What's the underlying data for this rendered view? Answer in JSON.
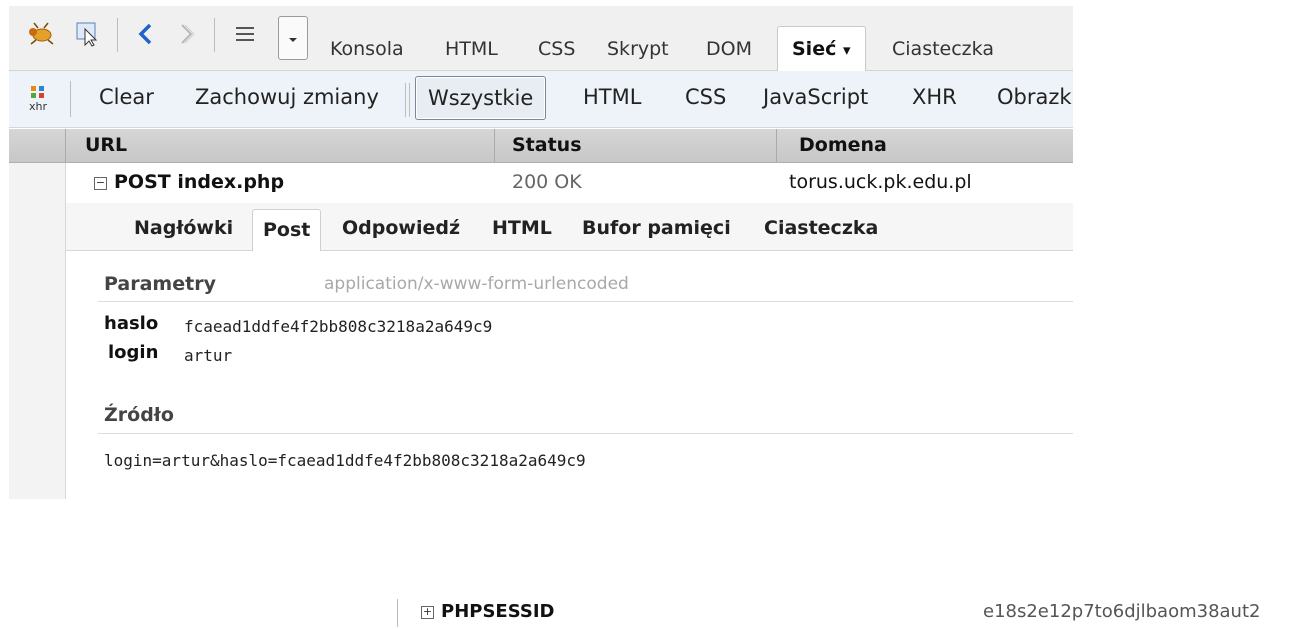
{
  "toolbar": {
    "tabs": [
      "Konsola",
      "HTML",
      "CSS",
      "Skrypt",
      "DOM",
      "Sieć",
      "Ciasteczka"
    ],
    "active_tab_arrow": "▾"
  },
  "net_toolbar": {
    "xhr_icon_label": "xhr",
    "buttons": [
      "Clear",
      "Zachowuj zmiany",
      "Wszystkie",
      "HTML",
      "CSS",
      "JavaScript",
      "XHR",
      "Obrazki"
    ]
  },
  "columns": {
    "url": "URL",
    "status": "Status",
    "domain": "Domena"
  },
  "request": {
    "method_file": "POST index.php",
    "status": "200 OK",
    "domain": "torus.uck.pk.edu.pl"
  },
  "detail_tabs": [
    "Nagłówki",
    "Post",
    "Odpowiedź",
    "HTML",
    "Bufor pamięci",
    "Ciasteczka"
  ],
  "post": {
    "params_title": "Parametry",
    "content_type": "application/x-www-form-urlencoded",
    "params": [
      {
        "key": "haslo",
        "value": "fcaead1ddfe4f2bb808c3218a2a649c9"
      },
      {
        "key": "login",
        "value": "artur"
      }
    ],
    "source_title": "Źródło",
    "source": "login=artur&haslo=fcaead1ddfe4f2bb808c3218a2a649c9"
  },
  "cookie": {
    "name": "PHPSESSID",
    "value": "e18s2e12p7to6djlbaom38aut2"
  }
}
